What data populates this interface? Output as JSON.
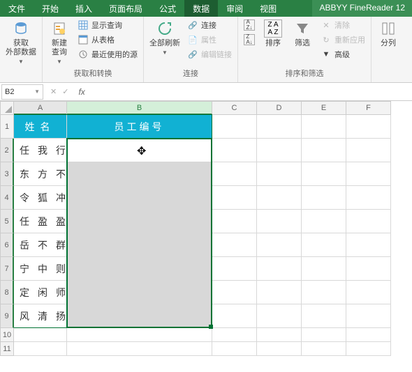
{
  "tabs": {
    "file": "文件",
    "home": "开始",
    "insert": "插入",
    "layout": "页面布局",
    "formula": "公式",
    "data": "数据",
    "review": "审阅",
    "view": "视图",
    "addon": "ABBYY FineReader 12"
  },
  "ribbon": {
    "get_external": "获取\n外部数据",
    "new_query": "新建\n查询",
    "show_query": "显示查询",
    "from_table": "从表格",
    "recent": "最近使用的源",
    "group1": "获取和转换",
    "refresh_all": "全部刷新",
    "connections": "连接",
    "properties": "属性",
    "edit_links": "编辑链接",
    "group2": "连接",
    "sort_asc": "A↓Z",
    "sort_desc": "Z↓A",
    "sort": "排序",
    "filter": "筛选",
    "clear": "清除",
    "reapply": "重新应用",
    "advanced": "高级",
    "group3": "排序和筛选",
    "text_to_cols": "分列"
  },
  "namebox": "B2",
  "grid": {
    "col_headers": [
      "A",
      "B",
      "C",
      "D",
      "E",
      "F"
    ],
    "row_headers": [
      "1",
      "2",
      "3",
      "4",
      "5",
      "6",
      "7",
      "8",
      "9",
      "10",
      "11"
    ],
    "header_row": {
      "A": "姓名",
      "B": "员工编号"
    },
    "data_rows": [
      {
        "A": "任我行"
      },
      {
        "A": "东方不败"
      },
      {
        "A": "令狐冲"
      },
      {
        "A": "任盈盈"
      },
      {
        "A": "岳不群"
      },
      {
        "A": "宁中则"
      },
      {
        "A": "定闲师太"
      },
      {
        "A": "风清扬"
      }
    ]
  },
  "chart_data": {
    "type": "table",
    "title": "",
    "columns": [
      "姓名",
      "员工编号"
    ],
    "rows": [
      [
        "任我行",
        ""
      ],
      [
        "东方不败",
        ""
      ],
      [
        "令狐冲",
        ""
      ],
      [
        "任盈盈",
        ""
      ],
      [
        "岳不群",
        ""
      ],
      [
        "宁中则",
        ""
      ],
      [
        "定闲师太",
        ""
      ],
      [
        "风清扬",
        ""
      ]
    ]
  }
}
